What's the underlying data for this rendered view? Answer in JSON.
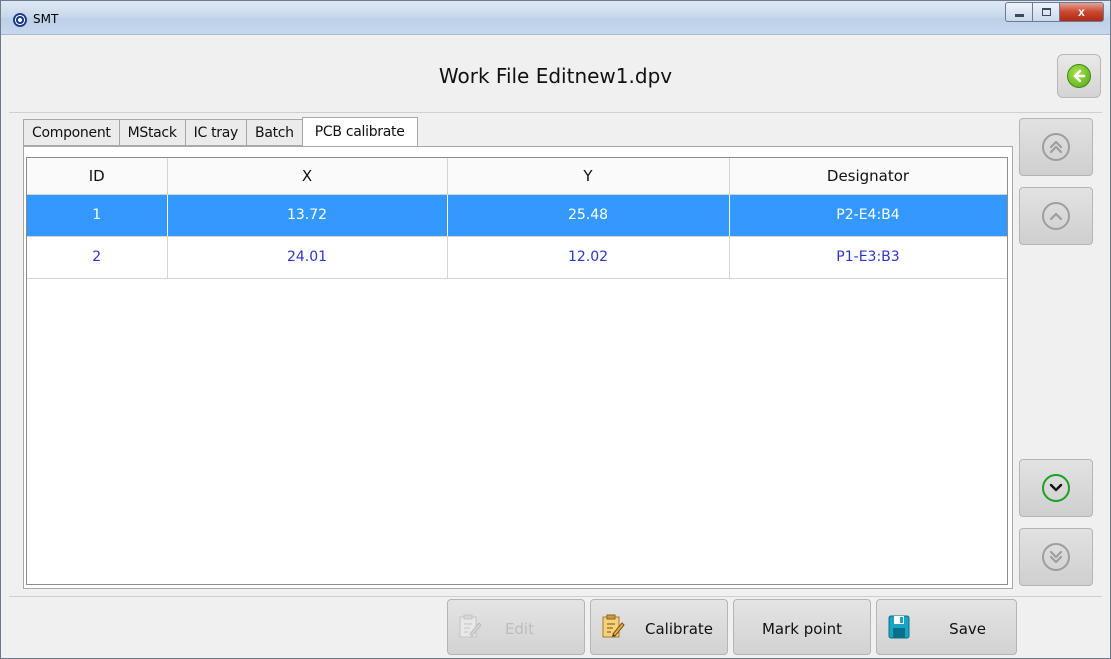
{
  "window": {
    "app_title": "SMT",
    "close_glyph": "x"
  },
  "header": {
    "title": "Work File Editnew1.dpv",
    "back_icon": "back-arrow-icon"
  },
  "tabs": [
    {
      "label": "Component"
    },
    {
      "label": "MStack"
    },
    {
      "label": "IC tray"
    },
    {
      "label": "Batch"
    },
    {
      "label": "PCB calibrate",
      "active": true
    }
  ],
  "table": {
    "columns": [
      "ID",
      "X",
      "Y",
      "Designator"
    ],
    "rows": [
      {
        "id": "1",
        "x": "13.72",
        "y": "25.48",
        "designator": "P2-E4:B4",
        "selected": true
      },
      {
        "id": "2",
        "x": "24.01",
        "y": "12.02",
        "designator": "P1-E3:B3",
        "selected": false
      }
    ]
  },
  "side_buttons": {
    "page_up": "double-chevron-up-icon",
    "row_up": "chevron-up-icon",
    "row_down": "chevron-down-icon",
    "page_down": "double-chevron-down-icon"
  },
  "toolbar": {
    "edit_label": "Edit",
    "calibrate_label": "Calibrate",
    "mark_point_label": "Mark point",
    "save_label": "Save"
  },
  "colors": {
    "selection": "#3399ff",
    "row_text": "#2b35c8",
    "enabled_indicator": "#1f9e2a"
  }
}
